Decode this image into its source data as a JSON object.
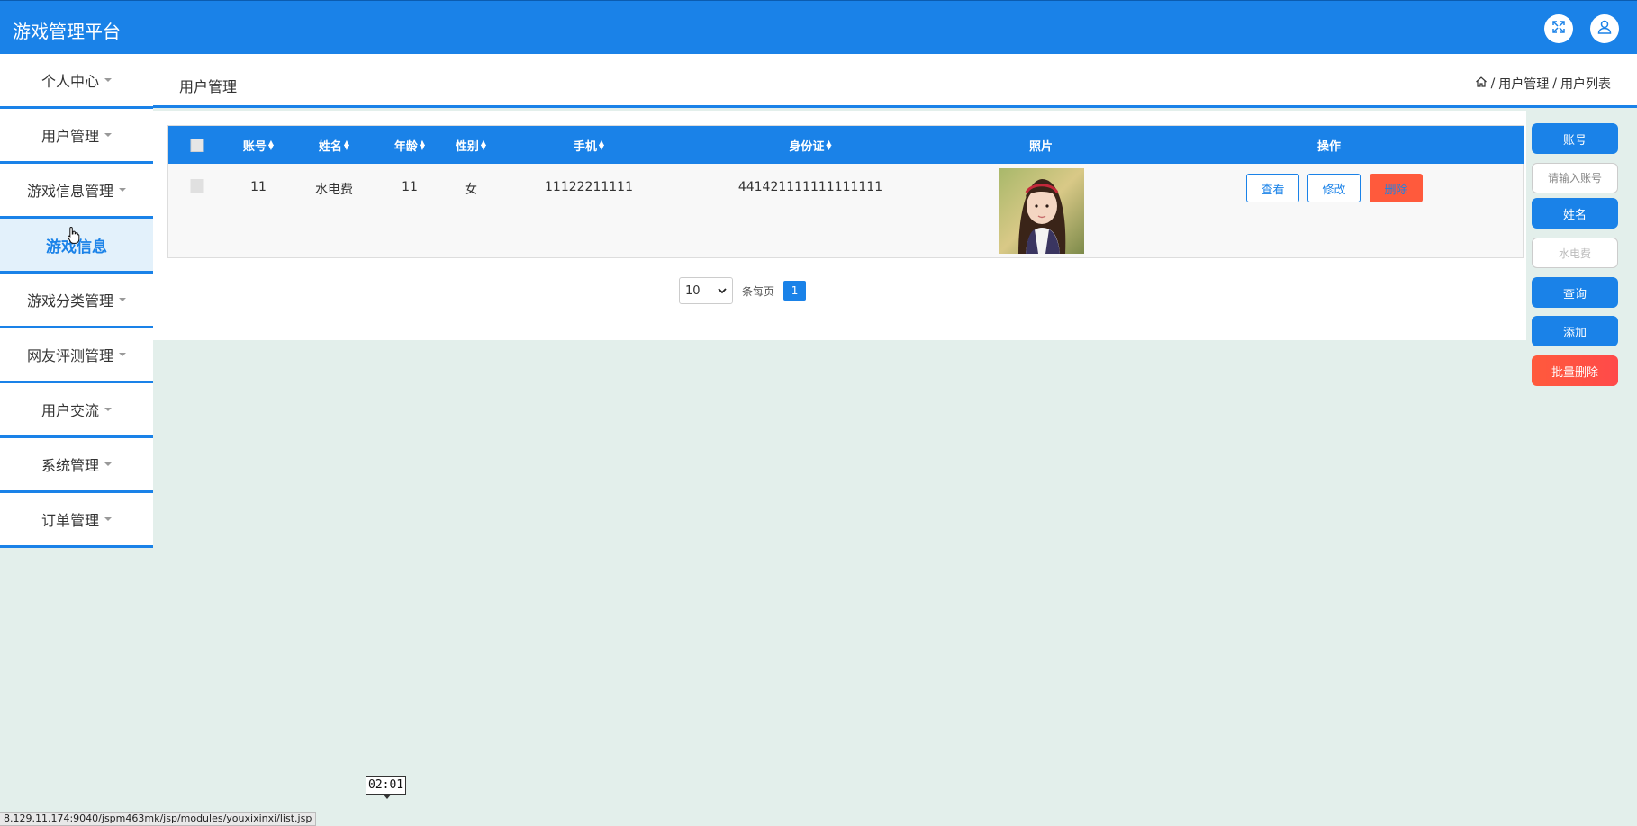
{
  "app": {
    "title": "游戏管理平台"
  },
  "header_icons": [
    "expand-icon",
    "user-icon"
  ],
  "nav": {
    "items": [
      {
        "label": "个人中心",
        "caret": true,
        "active": false
      },
      {
        "label": "用户管理",
        "caret": true,
        "active": false
      },
      {
        "label": "游戏信息管理",
        "caret": true,
        "active": false
      },
      {
        "label": "游戏信息",
        "caret": false,
        "active": true
      },
      {
        "label": "游戏分类管理",
        "caret": true,
        "active": false
      },
      {
        "label": "网友评测管理",
        "caret": true,
        "active": false
      },
      {
        "label": "用户交流",
        "caret": true,
        "active": false
      },
      {
        "label": "系统管理",
        "caret": true,
        "active": false
      },
      {
        "label": "订单管理",
        "caret": true,
        "active": false
      }
    ]
  },
  "page": {
    "title": "用户管理",
    "breadcrumb": [
      "用户管理",
      "用户列表"
    ],
    "breadcrumb_sep": "/"
  },
  "table": {
    "columns": [
      "账号",
      "姓名",
      "年龄",
      "性别",
      "手机",
      "身份证",
      "照片",
      "操作"
    ],
    "sortable": [
      true,
      true,
      true,
      true,
      true,
      true,
      false,
      false
    ],
    "rows": [
      {
        "account": "11",
        "name": "水电费",
        "age": "11",
        "gender": "女",
        "phone": "11122211111",
        "id_card": "441421111111111111",
        "photo": "photo-thumbnail",
        "actions": [
          "查看",
          "修改",
          "删除"
        ]
      }
    ]
  },
  "pager": {
    "page_size": "10",
    "per_page_label": "条每页",
    "current_page": "1"
  },
  "search": {
    "account_label": "账号",
    "account_placeholder": "请输入账号",
    "name_label": "姓名",
    "name_value": "水电费",
    "query_label": "查询",
    "add_label": "添加",
    "batch_delete_label": "批量删除"
  },
  "overlay": {
    "status_url": "8.129.11.174:9040/jspm463mk/jsp/modules/youxixinxi/list.jsp",
    "timer": "02:01"
  },
  "colors": {
    "primary": "#1a82e8",
    "danger": "#ff5a3c",
    "background": "#e3efeb"
  }
}
